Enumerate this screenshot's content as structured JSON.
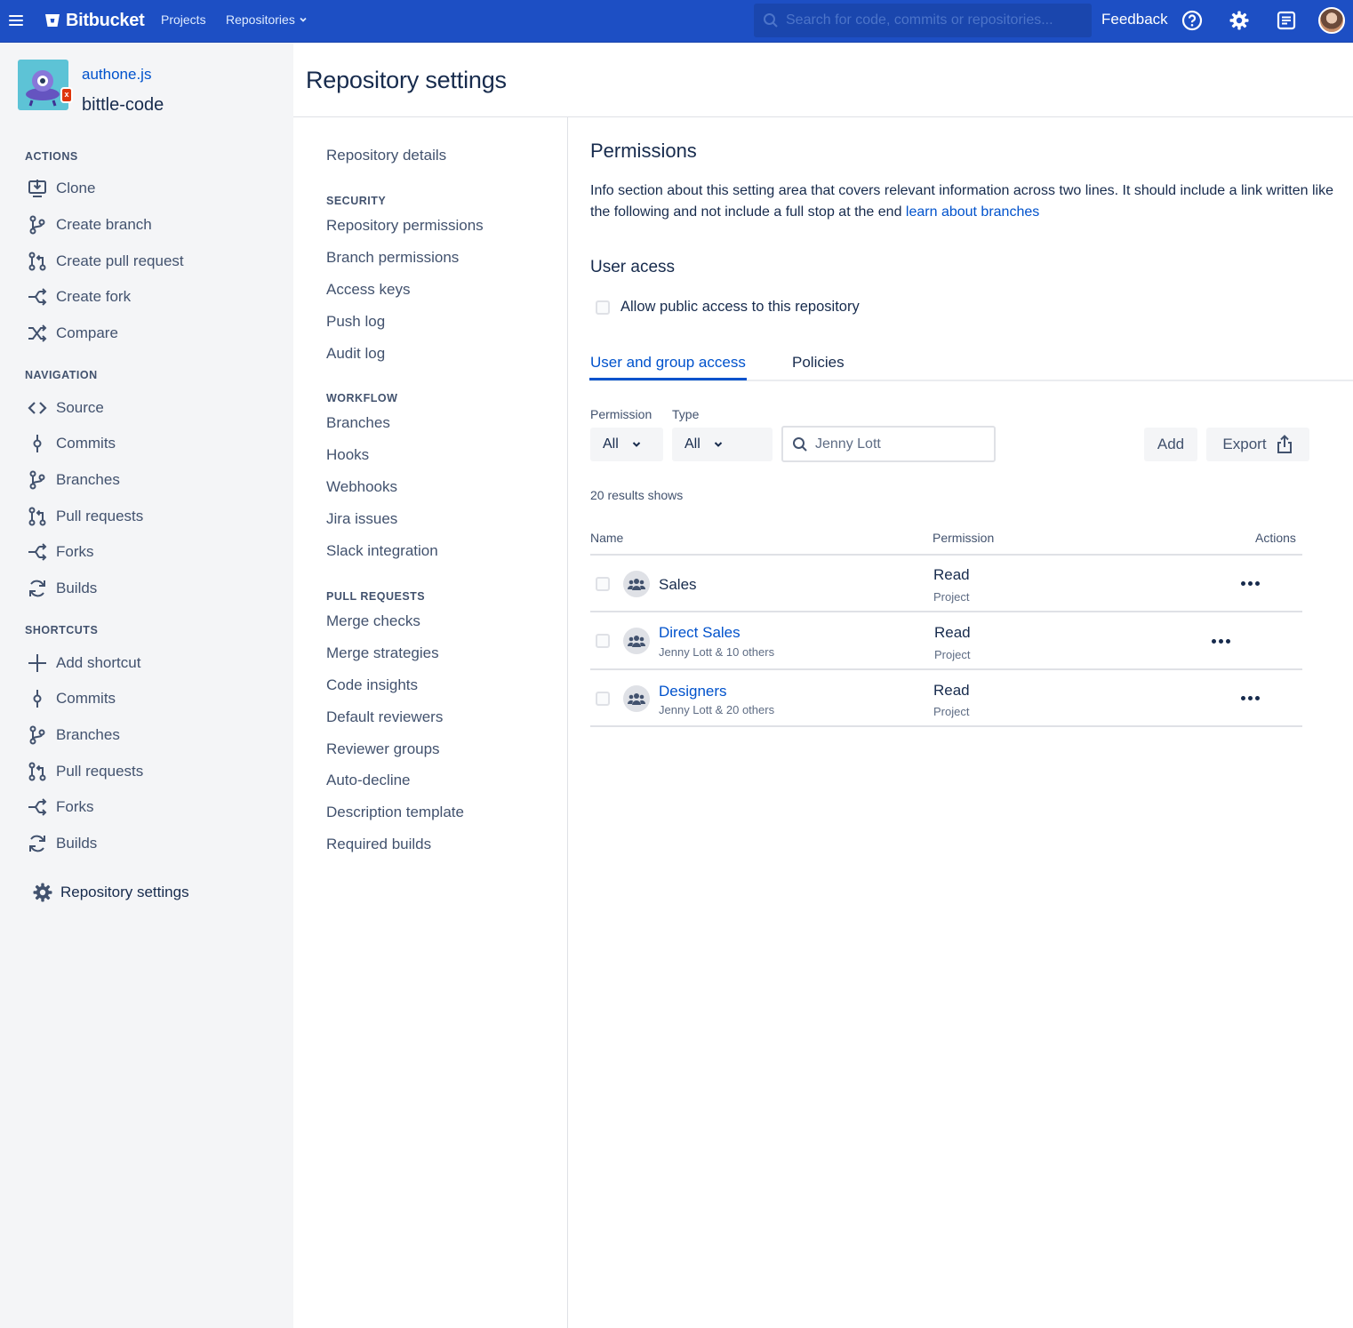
{
  "topbar": {
    "brand": "Bitbucket",
    "nav": {
      "projects": "Projects",
      "repositories": "Repositories"
    },
    "search_placeholder": "Search for code, commits or repositories...",
    "feedback": "Feedback",
    "icons": [
      "menu-icon",
      "bitbucket-logo-icon",
      "help-icon",
      "settings-icon",
      "notifications-icon",
      "avatar"
    ]
  },
  "repo": {
    "project": "authone.js",
    "name": "bittle-code"
  },
  "sidebar": {
    "actions_heading": "ACTIONS",
    "actions": [
      {
        "label": "Clone",
        "icon": "clone-icon"
      },
      {
        "label": "Create branch",
        "icon": "branch-icon"
      },
      {
        "label": "Create pull request",
        "icon": "pull-request-icon"
      },
      {
        "label": "Create fork",
        "icon": "fork-icon"
      },
      {
        "label": "Compare",
        "icon": "compare-icon"
      }
    ],
    "navigation_heading": "NAVIGATION",
    "navigation": [
      {
        "label": "Source",
        "icon": "source-icon"
      },
      {
        "label": "Commits",
        "icon": "commit-icon"
      },
      {
        "label": "Branches",
        "icon": "branch-icon"
      },
      {
        "label": "Pull requests",
        "icon": "pull-request-icon"
      },
      {
        "label": "Forks",
        "icon": "fork-icon"
      },
      {
        "label": "Builds",
        "icon": "builds-icon"
      }
    ],
    "shortcuts_heading": "SHORTCUTS",
    "shortcuts": [
      {
        "label": "Add shortcut",
        "icon": "add-icon"
      },
      {
        "label": "Commits",
        "icon": "commit-icon"
      },
      {
        "label": "Branches",
        "icon": "branch-icon"
      },
      {
        "label": "Pull requests",
        "icon": "pull-request-icon"
      },
      {
        "label": "Forks",
        "icon": "fork-icon"
      },
      {
        "label": "Builds",
        "icon": "builds-icon"
      }
    ],
    "settings": "Repository settings"
  },
  "page": {
    "title": "Repository settings"
  },
  "settings_nav": {
    "details": "Repository details",
    "security_heading": "SECURITY",
    "security": [
      "Repository permissions",
      "Branch permissions",
      "Access keys",
      "Push log",
      "Audit log"
    ],
    "workflow_heading": "WORKFLOW",
    "workflow": [
      "Branches",
      "Hooks",
      "Webhooks",
      "Jira issues",
      "Slack integration"
    ],
    "pull_requests_heading": "PULL REQUESTS",
    "pull_requests": [
      "Merge checks",
      "Merge strategies",
      "Code insights",
      "Default reviewers",
      "Reviewer groups",
      "Auto-decline",
      "Description template",
      "Required builds"
    ]
  },
  "permissions": {
    "title": "Permissions",
    "info": "Info section about this setting area that covers relevant information across two lines. It should include a link written like the following and not include a full stop at the end ",
    "info_link": "learn about branches",
    "user_access_title": "User acess",
    "public_access_label": "Allow public access to this repository",
    "public_access_checked": false,
    "tabs": [
      "User and group access",
      "Policies"
    ],
    "active_tab": "User and group access",
    "filters": {
      "permission_label": "Permission",
      "permission_value": "All",
      "type_label": "Type",
      "type_value": "All",
      "search_value": "Jenny Lott"
    },
    "buttons": {
      "add": "Add",
      "export": "Export"
    },
    "results_text": "20 results shows",
    "columns": {
      "name": "Name",
      "permission": "Permission",
      "actions": "Actions"
    },
    "rows": [
      {
        "name": "Sales",
        "subtitle": "",
        "permission": "Read",
        "scope": "Project"
      },
      {
        "name": "Direct Sales",
        "subtitle": "Jenny Lott & 10 others",
        "permission": "Read",
        "scope": "Project"
      },
      {
        "name": "Designers",
        "subtitle": "Jenny Lott & 20 others",
        "permission": "Read",
        "scope": "Project"
      }
    ]
  },
  "colors": {
    "brand_blue": "#1d4fc4",
    "link_blue": "#0052cc",
    "text": "#172b4d",
    "subtle": "#42526e",
    "sidebar_bg": "#f4f5f7"
  }
}
